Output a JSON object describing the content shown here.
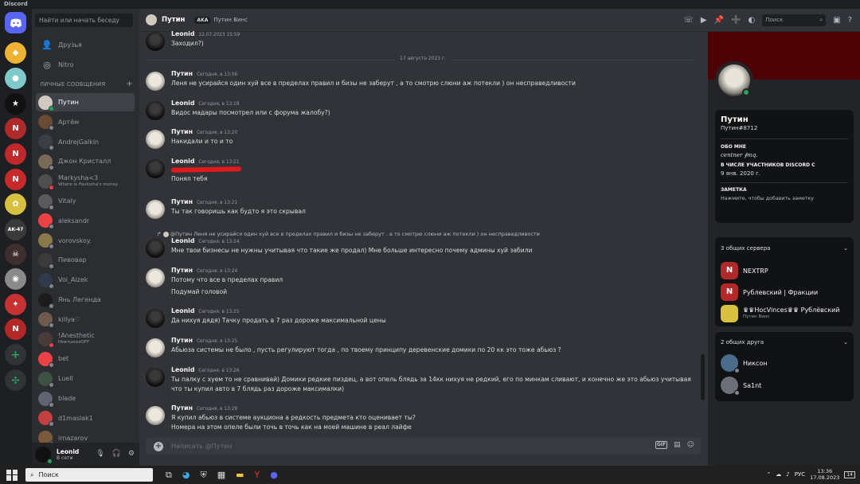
{
  "window": {
    "title": "Discord"
  },
  "dm_sidebar": {
    "search_placeholder": "Найти или начать беседу",
    "nav": [
      {
        "label": "Друзья",
        "icon": "friends-icon"
      },
      {
        "label": "Nitro",
        "icon": "nitro-icon"
      }
    ],
    "dm_header": "ЛИЧНЫЕ СООБЩЕНИЯ",
    "add_icon": "+",
    "dms": [
      {
        "name": "Путин",
        "status": "online",
        "color": "#cfc9bf",
        "selected": true
      },
      {
        "name": "Артём",
        "status": "offline",
        "color": "#6a4b34"
      },
      {
        "name": "AndrejGalkin",
        "status": "offline",
        "color": "#3a3e47"
      },
      {
        "name": "Джон Кристалл",
        "status": "offline",
        "color": "#7a6a58"
      },
      {
        "name": "Markysha<3",
        "sub": "Where is Pavlusha's money",
        "status": "dnd",
        "color": "#4f4f4f"
      },
      {
        "name": "Vitaly",
        "status": "offline",
        "color": "#5a5a5a"
      },
      {
        "name": "aleksandr",
        "status": "offline",
        "color": "#ed4245"
      },
      {
        "name": "vorovskoy.",
        "status": "offline",
        "color": "#8a7a4a"
      },
      {
        "name": "Пивовар",
        "status": "offline",
        "color": "#3b3b3b"
      },
      {
        "name": "Voi_Aizek",
        "status": "offline",
        "color": "#2f3b4a"
      },
      {
        "name": "Янь Легенда",
        "status": "offline",
        "color": "#1c1c1c"
      },
      {
        "name": "killya♡",
        "status": "offline",
        "color": "#6e5a4e"
      },
      {
        "name": "!Anesthetic",
        "sub": "НевтыкалOFF",
        "status": "dnd",
        "color": "#4a3b3b"
      },
      {
        "name": "bet",
        "status": "offline",
        "color": "#ed4245"
      },
      {
        "name": "Luell",
        "status": "offline",
        "color": "#3d5245"
      },
      {
        "name": "blade",
        "status": "offline",
        "color": "#5f6470"
      },
      {
        "name": "d1maslak1",
        "status": "offline",
        "color": "#c24040"
      },
      {
        "name": "irnazarov",
        "status": "offline",
        "color": "#7a5a3a"
      }
    ]
  },
  "user_panel": {
    "name": "Leonid",
    "status": "В сети",
    "icons": [
      "microphone-icon",
      "headphones-icon",
      "settings-icon"
    ]
  },
  "guild_bar": {
    "home_icon": "discord-logo-icon",
    "servers": [
      {
        "color": "#f0b232",
        "label": "◆"
      },
      {
        "color": "#7ec9c9",
        "label": "●"
      },
      {
        "color": "#111111",
        "label": "★"
      },
      {
        "color": "#b02a2a",
        "label": "N"
      },
      {
        "color": "#c0282a",
        "label": "N"
      },
      {
        "color": "#c82a2a",
        "label": "N"
      },
      {
        "color": "#d8c040",
        "label": "✿"
      },
      {
        "color": "#3a3a3a",
        "label": "AK-47"
      },
      {
        "color": "#3f2e2e",
        "label": "☠"
      },
      {
        "color": "#8a8a8a",
        "label": "◉"
      },
      {
        "color": "#c83232",
        "label": "✦"
      },
      {
        "color": "#b42828",
        "label": "N"
      }
    ],
    "add_server": "+",
    "explore": "✣"
  },
  "chat": {
    "header": {
      "name": "Путин",
      "aka_label": "AKA",
      "nickname": "Путин Винс",
      "search_placeholder": "Поиск"
    },
    "date_divider": "17 августа 2023 г.",
    "messages": [
      {
        "author": "Leonid",
        "time": "12.07.2023 15:59",
        "lines": [
          "Заходил?)"
        ],
        "avatar": "leonid"
      },
      {
        "author": "Путин",
        "time": "Сегодня, в 13:06",
        "lines": [
          "Леня не усирайся один хуй все в пределах правил и бизы не заберут , а то смотрю слюни аж потекли ) он несправедливости"
        ],
        "avatar": "putin"
      },
      {
        "author": "Leonid",
        "time": "Сегодня, в 13:18",
        "lines": [
          "Видос мадары посмотрел или с форума жалобу?)"
        ],
        "avatar": "leonid"
      },
      {
        "author": "Путин",
        "time": "Сегодня, в 13:20",
        "lines": [
          "Накидали и то и то"
        ],
        "avatar": "putin"
      },
      {
        "author": "Leonid",
        "time": "Сегодня, в 13:21",
        "lines": [
          "Понял тебя"
        ],
        "avatar": "leonid"
      },
      {
        "author": "Путин",
        "time": "Сегодня, в 13:21",
        "lines": [
          "Ты так говоришь как будто я это скрывал"
        ],
        "avatar": "putin"
      },
      {
        "author": "Leonid",
        "time": "Сегодня, в 13:24",
        "lines": [
          "Мне твои бизнесы не нужны учитывая что такие же продал) Мне больше интересно почему админы хуй забили"
        ],
        "avatar": "leonid"
      },
      {
        "author": "Путин",
        "time": "Сегодня, в 13:24",
        "lines": [
          "Потому что все в пределах правил",
          "Подумай головой"
        ],
        "avatar": "putin"
      },
      {
        "author": "Leonid",
        "time": "Сегодня, в 13:25",
        "lines": [
          "Да нихуя дядя) Тачку продать в 7 раз дороже максимальной цены"
        ],
        "avatar": "leonid"
      },
      {
        "author": "Путин",
        "time": "Сегодня, в 13:25",
        "lines": [
          "Абьюза системы не было , пусть регулируют тогда , по твоему принципу деревенские домики по 20 кк это тоже абьюз ?"
        ],
        "avatar": "putin"
      },
      {
        "author": "Leonid",
        "time": "Сегодня, в 13:26",
        "lines": [
          "Ты палку с хуем то не сравнивай) Домики редкие пиздец, а вот опель блядь за 14кк нихуя не редкий, его по минкам сливают, и конечно же это абьюз учитывая",
          "что ты купил авто в 7 блядь раз дороже максималки)"
        ],
        "avatar": "leonid"
      },
      {
        "author": "Путин",
        "time": "Сегодня, в 13:28",
        "lines": [
          "Я купил абьюз в системе аукциона а редкость предмета кто оценивает ты?",
          "Номера на этом опеле были точь в точь как на моей машине в реал лайфе"
        ],
        "avatar": "putin"
      }
    ],
    "reply_preview": "@Путин Леня не усирайся один хуй все в пределах правил и бизы не заберут , а то смотрю слюни аж потекли ) он несправедливости",
    "composer_placeholder": "Написать @Путин",
    "composer_icons": [
      "gif-icon",
      "sticker-icon",
      "emoji-icon"
    ]
  },
  "profile": {
    "banner_color": "#4d0306",
    "name": "Путин",
    "tag": "Путин#8712",
    "about_label": "ОБО МНЕ",
    "about_text": "centner ∮mq.",
    "member_since_label": "В ЧИСЛЕ УЧАСТНИКОВ DISCORD С",
    "member_since": "9 янв. 2020 г.",
    "note_label": "ЗАМЕТКА",
    "note_placeholder": "Нажмите, чтобы добавить заметку",
    "mutual_servers_label": "3 общих сервера",
    "mutual_servers": [
      {
        "name": "NEXTRP",
        "sub": "",
        "color": "#b02a2a"
      },
      {
        "name": "Рублевский | Фракции",
        "sub": "",
        "color": "#b42828"
      },
      {
        "name": "♛♛HocVinces♛♛ Рублёвский",
        "sub": "Путин Винс",
        "color": "#d8c040"
      }
    ],
    "mutual_friends_label": "2 общих друга",
    "mutual_friends": [
      {
        "name": "Никсон",
        "color": "#4a6b8a"
      },
      {
        "name": "Sa1nt",
        "color": "#6a6f78"
      }
    ]
  },
  "taskbar": {
    "search": "Поиск",
    "lang": "РУС",
    "time": "13:36",
    "date": "17.08.2023",
    "notif": "14"
  }
}
